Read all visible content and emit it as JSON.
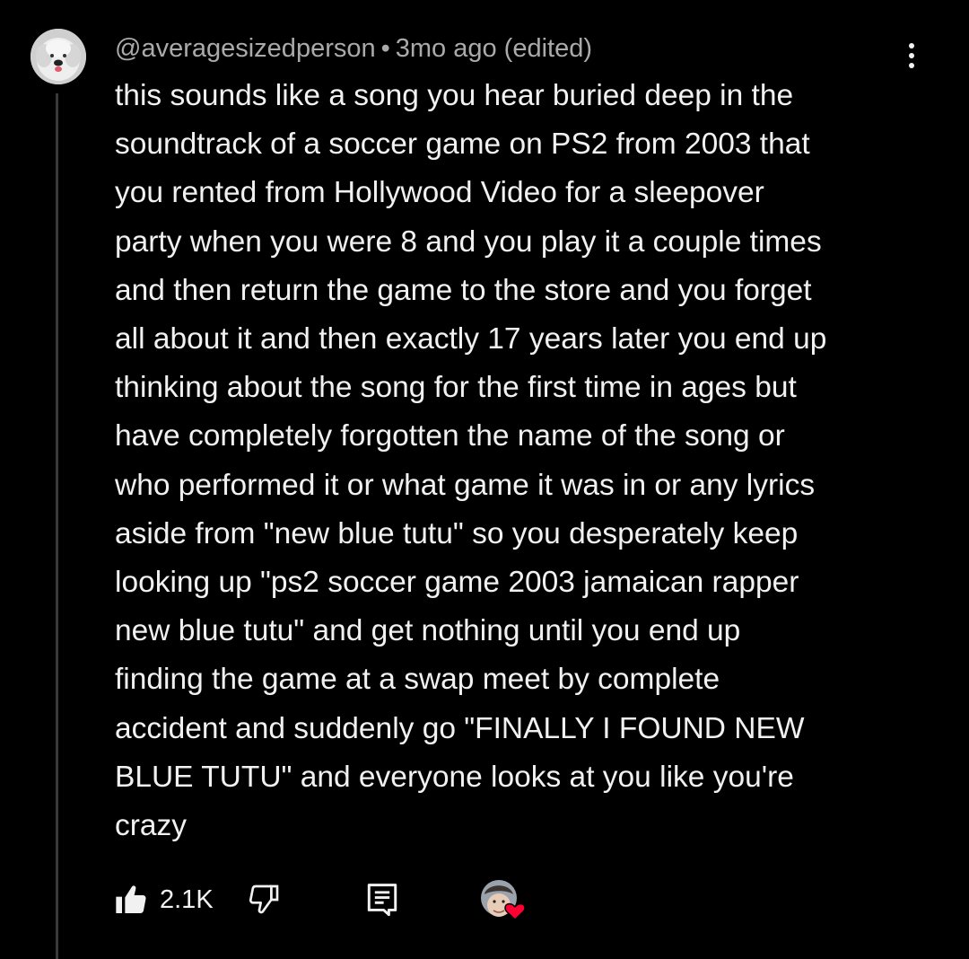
{
  "comment": {
    "author": "@averagesizedperson",
    "separator": "•",
    "timestamp": "3mo ago (edited)",
    "lines": [
      "this sounds like a song you hear buried deep in the",
      "soundtrack of a soccer game on PS2 from 2003 that",
      "you rented from Hollywood Video for a sleepover",
      "party when you were 8 and you play it a couple times",
      "and then return the game to the store and you forget",
      "all about it and then exactly 17 years later you end up",
      "thinking about the song for the first time in ages but",
      "have completely forgotten the name of the song or",
      "who performed it or what game it was in or any lyrics",
      "aside from \"new blue tutu\" so you desperately keep",
      "looking up \"ps2 soccer game 2003 jamaican rapper",
      "new blue tutu\" and get nothing until you end up",
      "finding the game at a swap meet by complete",
      "accident and suddenly go \"FINALLY I FOUND NEW",
      "BLUE TUTU\" and everyone looks at you like you're",
      "crazy"
    ]
  },
  "actions": {
    "like_count": "2.1K",
    "like_icon": "thumbs-up-icon",
    "dislike_icon": "thumbs-down-icon",
    "reply_icon": "reply-icon",
    "hearted_icon": "creator-heart-icon"
  },
  "colors": {
    "background": "#000000",
    "text_primary": "#f1f1f1",
    "text_secondary": "#aaaaaa",
    "thread_line": "#3a3a3a",
    "heart": "#ff0033"
  }
}
